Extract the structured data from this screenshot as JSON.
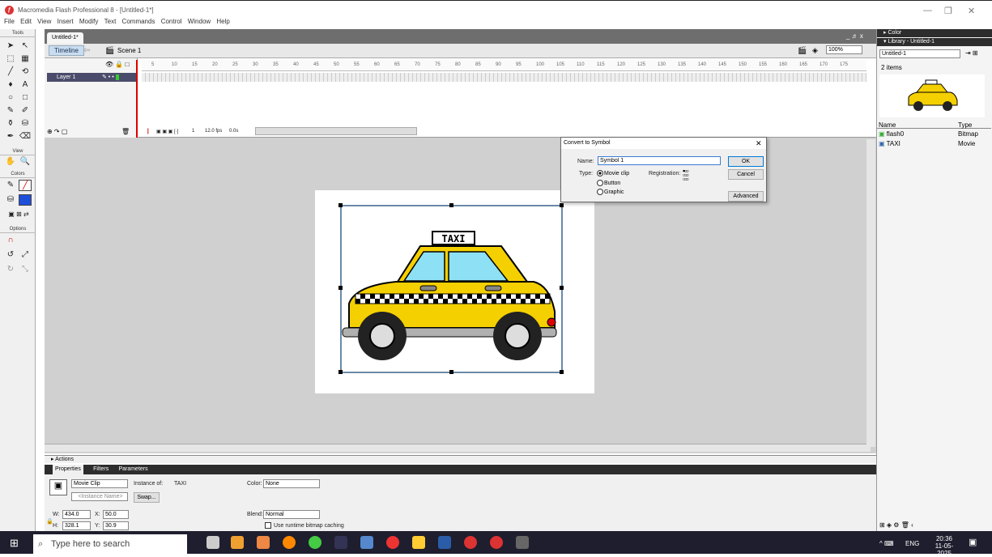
{
  "window": {
    "title": "Macromedia Flash Professional 8 - [Untitled-1*]"
  },
  "menu": [
    "File",
    "Edit",
    "View",
    "Insert",
    "Modify",
    "Text",
    "Commands",
    "Control",
    "Window",
    "Help"
  ],
  "tools": {
    "header": "Tools",
    "view_header": "View",
    "colors_header": "Colors",
    "options_header": "Options"
  },
  "document": {
    "tab": "Untitled-1*",
    "timeline_button": "Timeline",
    "scene": "Scene 1",
    "zoom": "100%",
    "panel_controls": "_ ♬ x"
  },
  "timeline": {
    "layer": "Layer 1",
    "ticks": [
      "5",
      "10",
      "15",
      "20",
      "25",
      "30",
      "35",
      "40",
      "45",
      "50",
      "55",
      "60",
      "65",
      "70",
      "75",
      "80",
      "85",
      "90",
      "95",
      "100",
      "105",
      "110",
      "115",
      "120",
      "125",
      "130",
      "135",
      "140",
      "145",
      "150",
      "155",
      "160",
      "165",
      "170",
      "175"
    ],
    "frame": "1",
    "fps": "12.0 fps",
    "time": "0.0s"
  },
  "stage": {
    "sign": "TAXI",
    "accent": "#f5d000"
  },
  "dialog": {
    "title": "Convert to Symbol",
    "name_label": "Name:",
    "name_value": "Symbol 1",
    "type_label": "Type:",
    "types": [
      "Movie clip",
      "Button",
      "Graphic"
    ],
    "registration_label": "Registration:",
    "ok": "OK",
    "cancel": "Cancel",
    "advanced": "Advanced"
  },
  "actions": {
    "label": "Actions"
  },
  "properties": {
    "tabs": [
      "Properties",
      "Filters",
      "Parameters"
    ],
    "symbol_type": "Movie Clip",
    "instance_of_label": "Instance of:",
    "instance_of": "TAXI",
    "instance_name_placeholder": "<Instance Name>",
    "swap": "Swap...",
    "color_label": "Color:",
    "color_value": "None",
    "blend_label": "Blend:",
    "blend_value": "Normal",
    "bitmap_cache": "Use runtime bitmap caching",
    "w_label": "W:",
    "w": "434.0",
    "x_label": "X:",
    "x": "50.0",
    "h_label": "H:",
    "h": "328.1",
    "y_label": "Y:",
    "y": "30.9"
  },
  "right_panel": {
    "color_header": "Color",
    "library_header": "Library - Untitled-1",
    "library_select": "Untitled-1",
    "item_count": "2 items",
    "col_name": "Name",
    "col_type": "Type",
    "items": [
      {
        "name": "flash0",
        "type": "Bitmap"
      },
      {
        "name": "TAXI",
        "type": "Movie"
      }
    ]
  },
  "taskbar": {
    "search": "Type here to search",
    "lang": "ENG",
    "time": "20:36",
    "date": "11-05-2025"
  }
}
